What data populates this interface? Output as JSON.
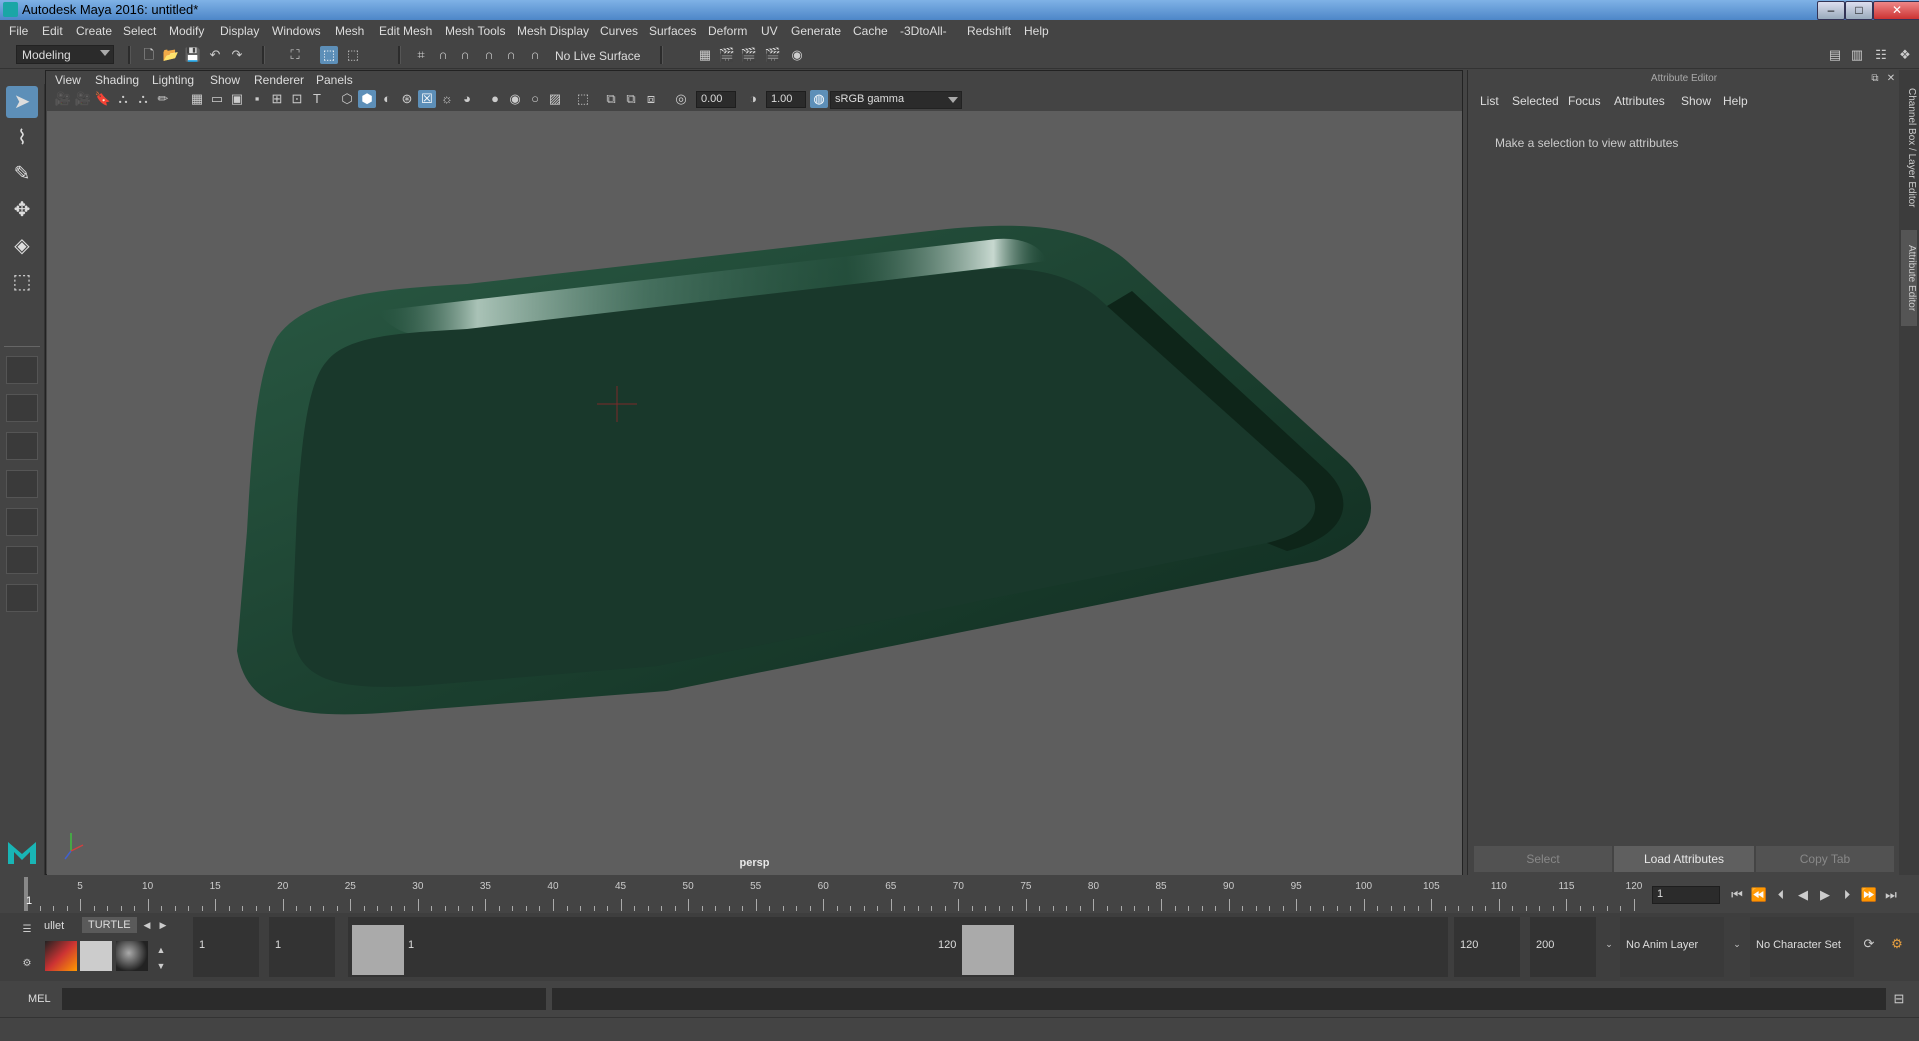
{
  "window": {
    "title": "Autodesk Maya 2016: untitled*"
  },
  "menubar": [
    "File",
    "Edit",
    "Create",
    "Select",
    "Modify",
    "Display",
    "Windows",
    "Mesh",
    "Edit Mesh",
    "Mesh Tools",
    "Mesh Display",
    "Curves",
    "Surfaces",
    "Deform",
    "UV",
    "Generate",
    "Cache",
    "-3DtoAll-",
    "Redshift",
    "Help"
  ],
  "statusline": {
    "mode": "Modeling",
    "live_surface": "No Live Surface"
  },
  "viewport": {
    "menu": [
      "View",
      "Shading",
      "Lighting",
      "Show",
      "Renderer",
      "Panels"
    ],
    "exposure": "0.00",
    "gamma": "1.00",
    "color_space": "sRGB gamma",
    "camera": "persp"
  },
  "attribute_editor": {
    "title": "Attribute Editor",
    "menu": [
      "List",
      "Selected",
      "Focus",
      "Attributes",
      "Show",
      "Help"
    ],
    "message": "Make a selection to view attributes",
    "buttons": {
      "select": "Select",
      "load": "Load Attributes",
      "copy": "Copy Tab"
    },
    "side_tabs": {
      "channel_box": "Channel Box / Layer Editor",
      "attr_editor": "Attribute Editor"
    }
  },
  "timeslider": {
    "ticks": [
      5,
      10,
      15,
      20,
      25,
      30,
      35,
      40,
      45,
      50,
      55,
      60,
      65,
      70,
      75,
      80,
      85,
      90,
      95,
      100,
      105,
      110,
      115,
      120
    ],
    "current_frame_marker": "1",
    "current_frame": "1"
  },
  "rangeslider": {
    "shelf_tabs": [
      "ullet",
      "TURTLE"
    ],
    "start_time": "1",
    "playback_start": "1",
    "range_start_label": "1",
    "range_end_label": "120",
    "playback_end": "120",
    "end_time": "200",
    "anim_layer": "No Anim Layer",
    "character_set": "No Character Set"
  },
  "cmdline": {
    "label": "MEL"
  }
}
